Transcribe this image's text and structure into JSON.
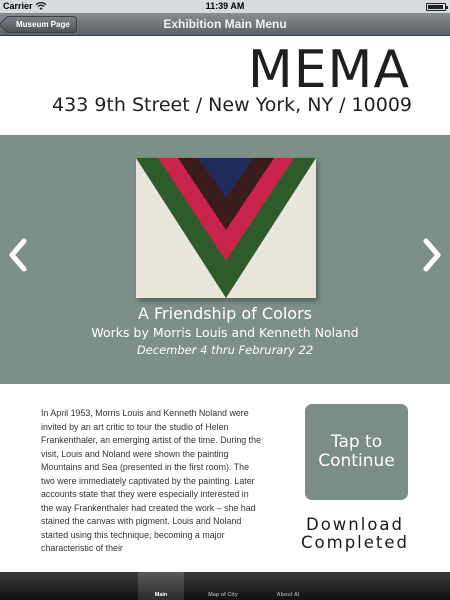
{
  "status_bar": {
    "carrier": "Carrier",
    "time": "11:39 AM"
  },
  "nav": {
    "back_label": "Museum Page",
    "title": "Exhibition Main Menu"
  },
  "header": {
    "brand": "MEMA",
    "address": "433 9th Street / New York, NY / 10009"
  },
  "exhibit": {
    "title": "A Friendship of Colors",
    "subtitle": "Works by Morris Louis and Kenneth Noland",
    "dates": "December 4 thru Februrary 22"
  },
  "description": "In April 1953, Morris Louis and Kenneth Noland were invited by an art critic to tour the studio of Helen Frankenthaler, an emerging artist of the time. During the visit, Louis and Noland were shown the painting Mountains and Sea (presented in the first room). The two were immediately captivated by the painting. Later accounts state that they were especially interested in the way Frankenthaler had created the work – she had stained the canvas with pigment. Louis and Noland started using this technique, becoming a major characteristic of their",
  "actions": {
    "continue_line1": "Tap to",
    "continue_line2": "Continue",
    "download_line1": "Download",
    "download_line2": "Completed"
  },
  "tabs": [
    {
      "label": "Main",
      "active": true
    },
    {
      "label": "Map of City",
      "active": false
    },
    {
      "label": "About AI",
      "active": false
    }
  ],
  "colors": {
    "panel": "#7c9088",
    "button": "#7a8e85"
  }
}
